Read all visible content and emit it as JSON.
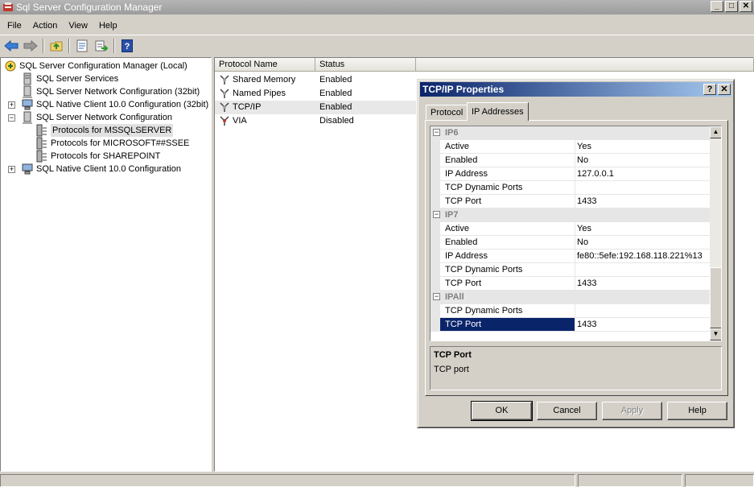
{
  "window": {
    "title": "Sql Server Configuration Manager",
    "min": "_",
    "max": "□",
    "close": "✕"
  },
  "menu": [
    "File",
    "Action",
    "View",
    "Help"
  ],
  "toolbar": {
    "icons": [
      "back-arrow-icon",
      "forward-arrow-icon",
      "up-folder-icon",
      "properties-icon",
      "export-list-icon",
      "help-icon"
    ]
  },
  "tree": {
    "root": "SQL Server Configuration Manager (Local)",
    "items": [
      "SQL Server Services",
      "SQL Server Network Configuration (32bit)",
      "SQL Native Client 10.0 Configuration (32bit)",
      "SQL Server Network Configuration",
      "Protocols for MSSQLSERVER",
      "Protocols for MICROSOFT##SSEE",
      "Protocols for SHAREPOINT",
      "SQL Native Client 10.0 Configuration"
    ]
  },
  "list": {
    "columns": [
      "Protocol Name",
      "Status"
    ],
    "rows": [
      {
        "name": "Shared Memory",
        "status": "Enabled"
      },
      {
        "name": "Named Pipes",
        "status": "Enabled"
      },
      {
        "name": "TCP/IP",
        "status": "Enabled"
      },
      {
        "name": "VIA",
        "status": "Disabled"
      }
    ]
  },
  "dialog": {
    "title": "TCP/IP Properties",
    "help_btn": "?",
    "close_btn": "✕",
    "tabs": [
      "Protocol",
      "IP Addresses"
    ],
    "groups": [
      {
        "name": "IP6",
        "props": [
          {
            "label": "Active",
            "value": "Yes"
          },
          {
            "label": "Enabled",
            "value": "No"
          },
          {
            "label": "IP Address",
            "value": "127.0.0.1"
          },
          {
            "label": "TCP Dynamic Ports",
            "value": ""
          },
          {
            "label": "TCP Port",
            "value": "1433"
          }
        ]
      },
      {
        "name": "IP7",
        "props": [
          {
            "label": "Active",
            "value": "Yes"
          },
          {
            "label": "Enabled",
            "value": "No"
          },
          {
            "label": "IP Address",
            "value": "fe80::5efe:192.168.118.221%13"
          },
          {
            "label": "TCP Dynamic Ports",
            "value": ""
          },
          {
            "label": "TCP Port",
            "value": "1433"
          }
        ]
      },
      {
        "name": "IPAll",
        "props": [
          {
            "label": "TCP Dynamic Ports",
            "value": ""
          },
          {
            "label": "TCP Port",
            "value": "1433"
          }
        ]
      }
    ],
    "description": {
      "title": "TCP Port",
      "text": "TCP port"
    },
    "buttons": {
      "ok": "OK",
      "cancel": "Cancel",
      "apply": "Apply",
      "help": "Help"
    },
    "colors": {
      "selection": "#0a246a",
      "title_start": "#0a246a",
      "title_end": "#a6caf0"
    }
  }
}
